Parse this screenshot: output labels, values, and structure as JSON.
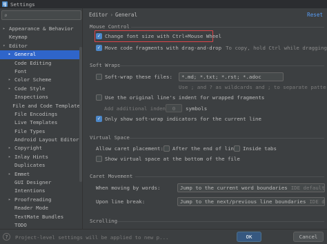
{
  "window": {
    "title": "Settings",
    "app_icon_letter": "IJ"
  },
  "search": {
    "placeholder": ""
  },
  "sidebar": {
    "items": [
      {
        "label": "Appearance & Behavior",
        "arrow": "▸",
        "level": 0
      },
      {
        "label": "Keymap",
        "arrow": "",
        "level": 0
      },
      {
        "label": "Editor",
        "arrow": "▾",
        "level": 0
      },
      {
        "label": "General",
        "arrow": "▸",
        "level": 1,
        "selected": true
      },
      {
        "label": "Code Editing",
        "arrow": "",
        "level": 1
      },
      {
        "label": "Font",
        "arrow": "",
        "level": 1
      },
      {
        "label": "Color Scheme",
        "arrow": "▸",
        "level": 1
      },
      {
        "label": "Code Style",
        "arrow": "▸",
        "level": 1
      },
      {
        "label": "Inspections",
        "arrow": "",
        "level": 1
      },
      {
        "label": "File and Code Template",
        "arrow": "",
        "level": 1
      },
      {
        "label": "File Encodings",
        "arrow": "",
        "level": 1
      },
      {
        "label": "Live Templates",
        "arrow": "",
        "level": 1
      },
      {
        "label": "File Types",
        "arrow": "",
        "level": 1
      },
      {
        "label": "Android Layout Editor",
        "arrow": "",
        "level": 1
      },
      {
        "label": "Copyright",
        "arrow": "▸",
        "level": 1
      },
      {
        "label": "Inlay Hints",
        "arrow": "▸",
        "level": 1
      },
      {
        "label": "Duplicates",
        "arrow": "",
        "level": 1
      },
      {
        "label": "Emmet",
        "arrow": "▸",
        "level": 1
      },
      {
        "label": "GUI Designer",
        "arrow": "",
        "level": 1
      },
      {
        "label": "Intentions",
        "arrow": "",
        "level": 1
      },
      {
        "label": "Proofreading",
        "arrow": "▸",
        "level": 1
      },
      {
        "label": "Reader Mode",
        "arrow": "",
        "level": 1
      },
      {
        "label": "TextMate Bundles",
        "arrow": "",
        "level": 1
      },
      {
        "label": "TODO",
        "arrow": "",
        "level": 1
      }
    ]
  },
  "breadcrumb": {
    "parent": "Editor",
    "separator": "›",
    "current": "General"
  },
  "reset_label": "Reset",
  "mouse_control": {
    "title": "Mouse Control",
    "change_font_size": "Change font size with Ctrl+Mouse Wheel",
    "move_fragments": "Move code fragments with drag-and-drop",
    "move_fragments_hint": "To copy, hold Ctrl while dragging"
  },
  "soft_wraps": {
    "title": "Soft Wraps",
    "soft_wrap_files": "Soft-wrap these files:",
    "soft_wrap_value": "*.md; *.txt; *.rst; *.adoc",
    "soft_wrap_hint": "Use ; and ? as wildcards and ; to separate patterns",
    "original_indent": "Use the original line's indent for wrapped fragments",
    "additional_indent_label": "Add additional indent:",
    "additional_indent_value": "0",
    "additional_indent_unit": "symbols",
    "show_indicators": "Only show soft-wrap indicators for the current line"
  },
  "virtual_space": {
    "title": "Virtual Space",
    "caret_label": "Allow caret placement:",
    "after_end": "After the end of line",
    "inside_tabs": "Inside tabs",
    "show_virtual": "Show virtual space at the bottom of the file"
  },
  "caret_movement": {
    "title": "Caret Movement",
    "by_words_label": "When moving by words:",
    "by_words_value": "Jump to the current word boundaries",
    "by_words_default": "IDE default",
    "line_break_label": "Upon line break:",
    "line_break_value": "Jump to the next/previous line boundaries",
    "line_break_default": "IDE default"
  },
  "scrolling": {
    "title": "Scrolling"
  },
  "footer": {
    "help_icon": "?",
    "note": "Project-level settings will be applied to new p...",
    "ok_label": "OK",
    "cancel_label": "Cancel"
  },
  "colors": {
    "accent": "#2f65ca",
    "highlight_border": "#e0464b",
    "checkbox_checked": "#4c87c8"
  }
}
